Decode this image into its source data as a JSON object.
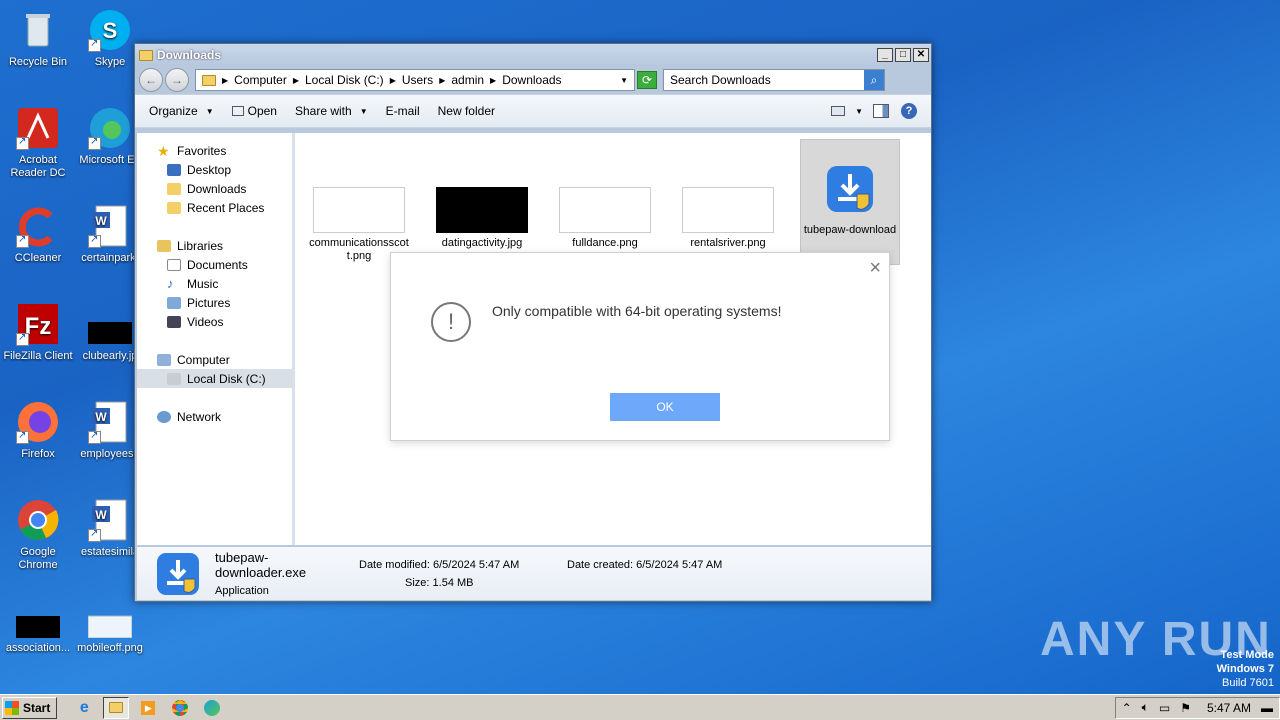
{
  "desktop": {
    "icons": [
      {
        "label": "Recycle Bin"
      },
      {
        "label": "Skype"
      },
      {
        "label": "Acrobat Reader DC"
      },
      {
        "label": "Microsoft Ed"
      },
      {
        "label": "CCleaner"
      },
      {
        "label": "certainpark."
      },
      {
        "label": "FileZilla Client"
      },
      {
        "label": "clubearly.jp"
      },
      {
        "label": "Firefox"
      },
      {
        "label": "employeesh"
      },
      {
        "label": "Google Chrome"
      },
      {
        "label": "estatesimila"
      },
      {
        "label": "association..."
      },
      {
        "label": "mobileoff.png"
      }
    ]
  },
  "window": {
    "title": "Downloads",
    "address": {
      "segments": [
        "Computer",
        "Local Disk (C:)",
        "Users",
        "admin",
        "Downloads"
      ]
    },
    "search_placeholder": "Search Downloads",
    "toolbar": {
      "organize": "Organize",
      "open": "Open",
      "share_with": "Share with",
      "email": "E-mail",
      "new_folder": "New folder"
    },
    "nav": {
      "favorites": "Favorites",
      "desktop": "Desktop",
      "downloads": "Downloads",
      "recent_places": "Recent Places",
      "libraries": "Libraries",
      "documents": "Documents",
      "music": "Music",
      "pictures": "Pictures",
      "videos": "Videos",
      "computer": "Computer",
      "local_disk": "Local Disk (C:)",
      "network": "Network"
    },
    "files": [
      {
        "name": "communicationsscott.png"
      },
      {
        "name": "datingactivity.jpg"
      },
      {
        "name": "fulldance.png"
      },
      {
        "name": "rentalsriver.png"
      },
      {
        "name": "tubepaw-download"
      }
    ],
    "details": {
      "name": "tubepaw-downloader.exe",
      "type": "Application",
      "date_modified_label": "Date modified:",
      "date_modified": "6/5/2024 5:47 AM",
      "size_label": "Size:",
      "size": "1.54 MB",
      "date_created_label": "Date created:",
      "date_created": "6/5/2024 5:47 AM"
    }
  },
  "dialog": {
    "message": "Only compatible with 64-bit operating systems!",
    "ok": "OK",
    "close": "×"
  },
  "watermark": {
    "brand": "ANY RUN",
    "test_mode": "Test Mode",
    "os": "Windows 7",
    "build": "Build 7601"
  },
  "taskbar": {
    "start": "Start",
    "clock": "5:47 AM"
  },
  "colors": {
    "accent": "#6ea8fb",
    "desktop": "#1a63c4"
  }
}
